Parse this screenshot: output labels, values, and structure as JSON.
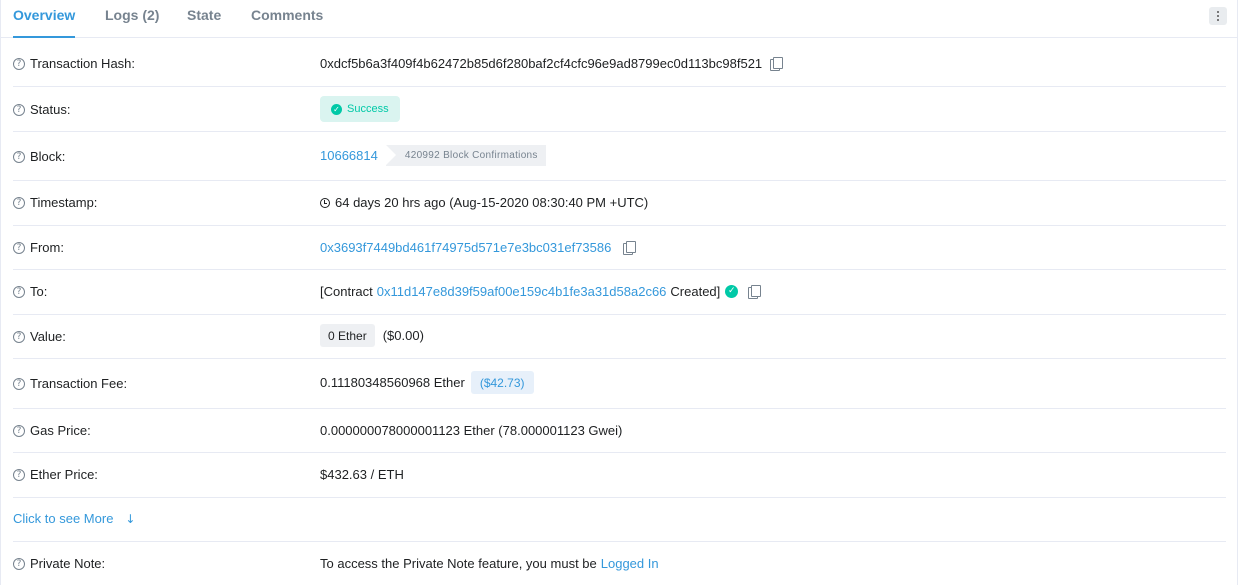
{
  "tabs": [
    {
      "label": "Overview"
    },
    {
      "label": "Logs (2)"
    },
    {
      "label": "State"
    },
    {
      "label": "Comments"
    }
  ],
  "rows": {
    "tx_hash": {
      "label": "Transaction Hash:",
      "value": "0xdcf5b6a3f409f4b62472b85d6f280baf2cf4cfc96e9ad8799ec0d113bc98f521"
    },
    "status": {
      "label": "Status:",
      "value": "Success"
    },
    "block": {
      "label": "Block:",
      "value": "10666814",
      "confirmations": "420992 Block Confirmations"
    },
    "timestamp": {
      "label": "Timestamp:",
      "value": "64 days 20 hrs ago (Aug-15-2020 08:30:40 PM +UTC)"
    },
    "from": {
      "label": "From:",
      "value": "0x3693f7449bd461f74975d571e7e3bc031ef73586"
    },
    "to": {
      "label": "To:",
      "prefix": "[Contract",
      "address": "0x11d147e8d39f59af00e159c4b1fe3a31d58a2c66",
      "suffix": "Created]"
    },
    "value": {
      "label": "Value:",
      "amount": "0 Ether",
      "usd": "($0.00)"
    },
    "fee": {
      "label": "Transaction Fee:",
      "amount": "0.11180348560968 Ether",
      "usd": "($42.73)"
    },
    "gas_price": {
      "label": "Gas Price:",
      "value": "0.000000078000001123 Ether (78.000001123 Gwei)"
    },
    "ether_price": {
      "label": "Ether Price:",
      "value": "$432.63 / ETH"
    },
    "private_note": {
      "label": "Private Note:",
      "text": "To access the Private Note feature, you must be",
      "link": "Logged In"
    }
  },
  "more_link": "Click to see More",
  "colors": {
    "accent": "#3498db",
    "success": "#00c9a7",
    "border": "#e7eaf3"
  },
  "icons": [
    "question-circle-icon",
    "copy-icon",
    "check-circle-icon",
    "clock-icon",
    "arrow-down-icon",
    "kebab-menu-icon"
  ]
}
